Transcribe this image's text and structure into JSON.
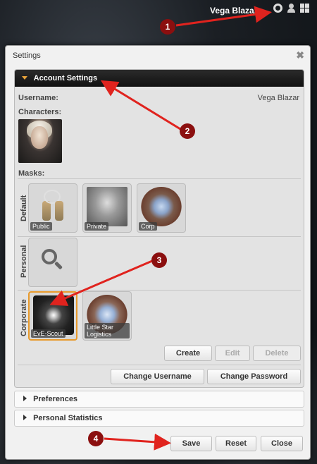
{
  "topbar": {
    "username": "Vega Blazar"
  },
  "dialog": {
    "title": "Settings",
    "close_glyph": "✖",
    "account_section": {
      "header": "Account Settings",
      "username_label": "Username:",
      "username_value": "Vega Blazar",
      "characters_label": "Characters:",
      "masks_label": "Masks:",
      "groups": {
        "default": {
          "label": "Default",
          "masks": [
            "Public",
            "Private",
            "Corp"
          ]
        },
        "personal": {
          "label": "Personal"
        },
        "corporate": {
          "label": "Corporate",
          "masks": [
            "EvE-Scout",
            "Little Star Logistics"
          ]
        }
      },
      "buttons": {
        "create": "Create",
        "edit": "Edit",
        "delete": "Delete",
        "change_username": "Change Username",
        "change_password": "Change Password"
      }
    },
    "sections": [
      "Preferences",
      "Personal Statistics"
    ],
    "footer": {
      "save": "Save",
      "reset": "Reset",
      "close": "Close"
    }
  },
  "annotations": [
    "1",
    "2",
    "3",
    "4"
  ],
  "colors": {
    "accent": "#e89a2c",
    "annotation": "#8b0f0f",
    "arrow": "#e0231e"
  }
}
